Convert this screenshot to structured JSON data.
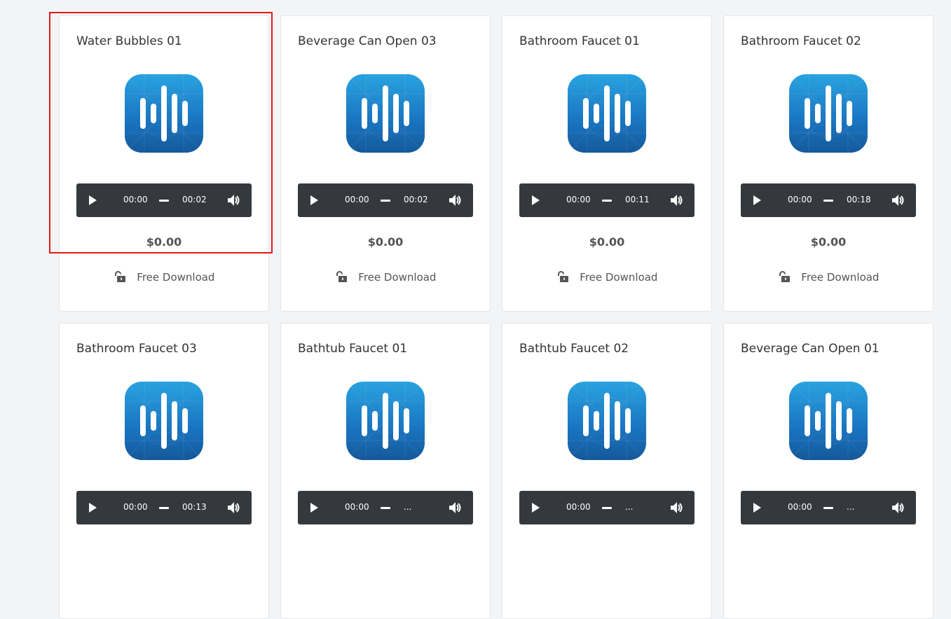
{
  "cards": [
    {
      "title": "Water Bubbles 01",
      "current_time": "00:00",
      "duration": "00:02",
      "price": "$0.00",
      "download_label": "Free Download"
    },
    {
      "title": "Beverage Can Open 03",
      "current_time": "00:00",
      "duration": "00:02",
      "price": "$0.00",
      "download_label": "Free Download"
    },
    {
      "title": "Bathroom Faucet 01",
      "current_time": "00:00",
      "duration": "00:11",
      "price": "$0.00",
      "download_label": "Free Download"
    },
    {
      "title": "Bathroom Faucet 02",
      "current_time": "00:00",
      "duration": "00:18",
      "price": "$0.00",
      "download_label": "Free Download"
    },
    {
      "title": "Bathroom Faucet 03",
      "current_time": "00:00",
      "duration": "00:13",
      "price": "",
      "download_label": ""
    },
    {
      "title": "Bathtub Faucet 01",
      "current_time": "00:00",
      "duration": "...",
      "price": "",
      "download_label": ""
    },
    {
      "title": "Bathtub Faucet 02",
      "current_time": "00:00",
      "duration": "...",
      "price": "",
      "download_label": ""
    },
    {
      "title": "Beverage Can Open 01",
      "current_time": "00:00",
      "duration": "...",
      "price": "",
      "download_label": ""
    }
  ],
  "icons": {
    "sound": "sound-wave-icon",
    "play": "play-icon",
    "volume": "volume-icon",
    "lock": "unlock-icon"
  },
  "colors": {
    "accent_blue": "#1a74c0",
    "player_bg": "#35393e",
    "highlight": "#e01b1b"
  },
  "selected_card": 0
}
